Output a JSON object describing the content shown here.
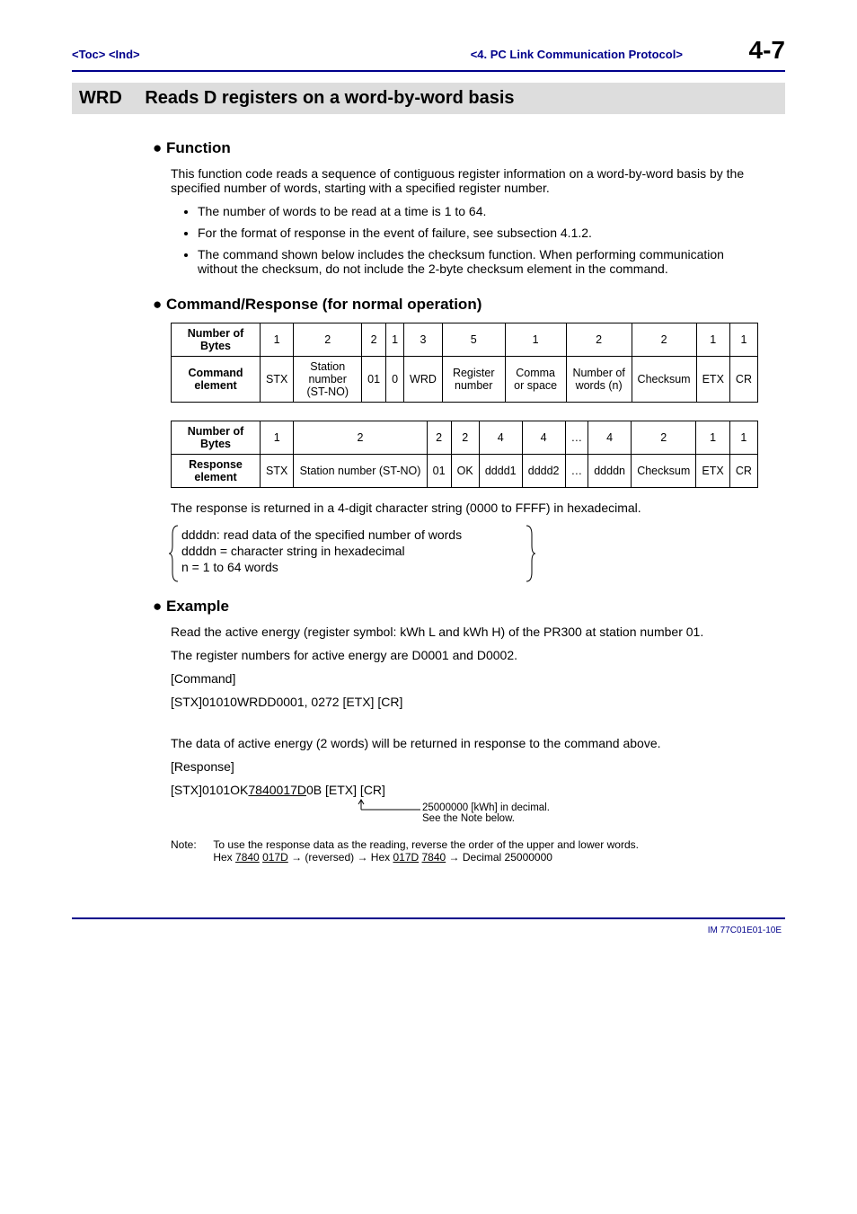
{
  "header": {
    "left_toc": "<Toc>",
    "left_ind": "<Ind>",
    "chapter": "<4.  PC Link Communication Protocol>",
    "page": "4-7"
  },
  "title": {
    "code": "WRD",
    "text": "Reads D registers on a word-by-word basis"
  },
  "function": {
    "heading": "Function",
    "para": "This function code reads a sequence of contiguous register information on a word-by-word basis by the specified number of words, starting with a specified register number.",
    "bullets": [
      "The number of words to be read at a time is 1 to 64.",
      "For the format of response in the event of failure, see subsection 4.1.2.",
      "The command shown below includes the checksum function. When performing communication without the checksum, do not include the 2-byte checksum element in the command."
    ]
  },
  "cmdresp": {
    "heading": "Command/Response (for normal operation)",
    "row_label_bytes": "Number of Bytes",
    "row_label_cmd": "Command element",
    "row_label_resp": "Response element",
    "command": {
      "bytes": [
        "1",
        "2",
        "2",
        "1",
        "3",
        "5",
        "1",
        "2",
        "2",
        "1",
        "1"
      ],
      "elems": [
        "STX",
        "Station number (ST-NO)",
        "01",
        "0",
        "WRD",
        "Register number",
        "Comma or space",
        "Number of words (n)",
        "Checksum",
        "ETX",
        "CR"
      ]
    },
    "response": {
      "bytes": [
        "1",
        "2",
        "2",
        "2",
        "4",
        "4",
        "…",
        "4",
        "2",
        "1",
        "1"
      ],
      "elems": [
        "STX",
        "Station number (ST-NO)",
        "01",
        "OK",
        "dddd1",
        "dddd2",
        "…",
        "ddddn",
        "Checksum",
        "ETX",
        "CR"
      ]
    },
    "resp_text": "The response is returned in a 4-digit character string (0000 to FFFF) in hexadecimal.",
    "desc1": "ddddn: read data of the specified number of words",
    "desc2": "ddddn = character string in hexadecimal",
    "desc3": "n = 1 to 64 words"
  },
  "example": {
    "heading": "Example",
    "p1": "Read the active energy (register symbol: kWh L and kWh H) of the PR300 at station number 01.",
    "p2": "The register numbers for active energy are D0001 and D0002.",
    "p3": "[Command]",
    "p4": "[STX]01010WRDD0001, 0272 [ETX] [CR]",
    "p5": "The data of active energy (2 words) will be returned in response to the command above.",
    "p6": "[Response]",
    "resp_pre": "[STX]0101OK",
    "resp_mid": "7840017D",
    "resp_post": "0B [ETX] [CR]",
    "annot1": "25000000 [kWh] in decimal.",
    "annot2": "See the Note below.",
    "note_label": "Note:",
    "note_text": "To use the response data as the reading, reverse the order of the upper and lower words.",
    "note_line_pre": "Hex ",
    "note_u1": "7840",
    "note_sp": " ",
    "note_u2": "017D",
    "note_mid1": " → (reversed) → Hex ",
    "note_u3": "017D",
    "note_u4": "7840",
    "note_end": " → Decimal 25000000"
  },
  "footer": "IM 77C01E01-10E"
}
